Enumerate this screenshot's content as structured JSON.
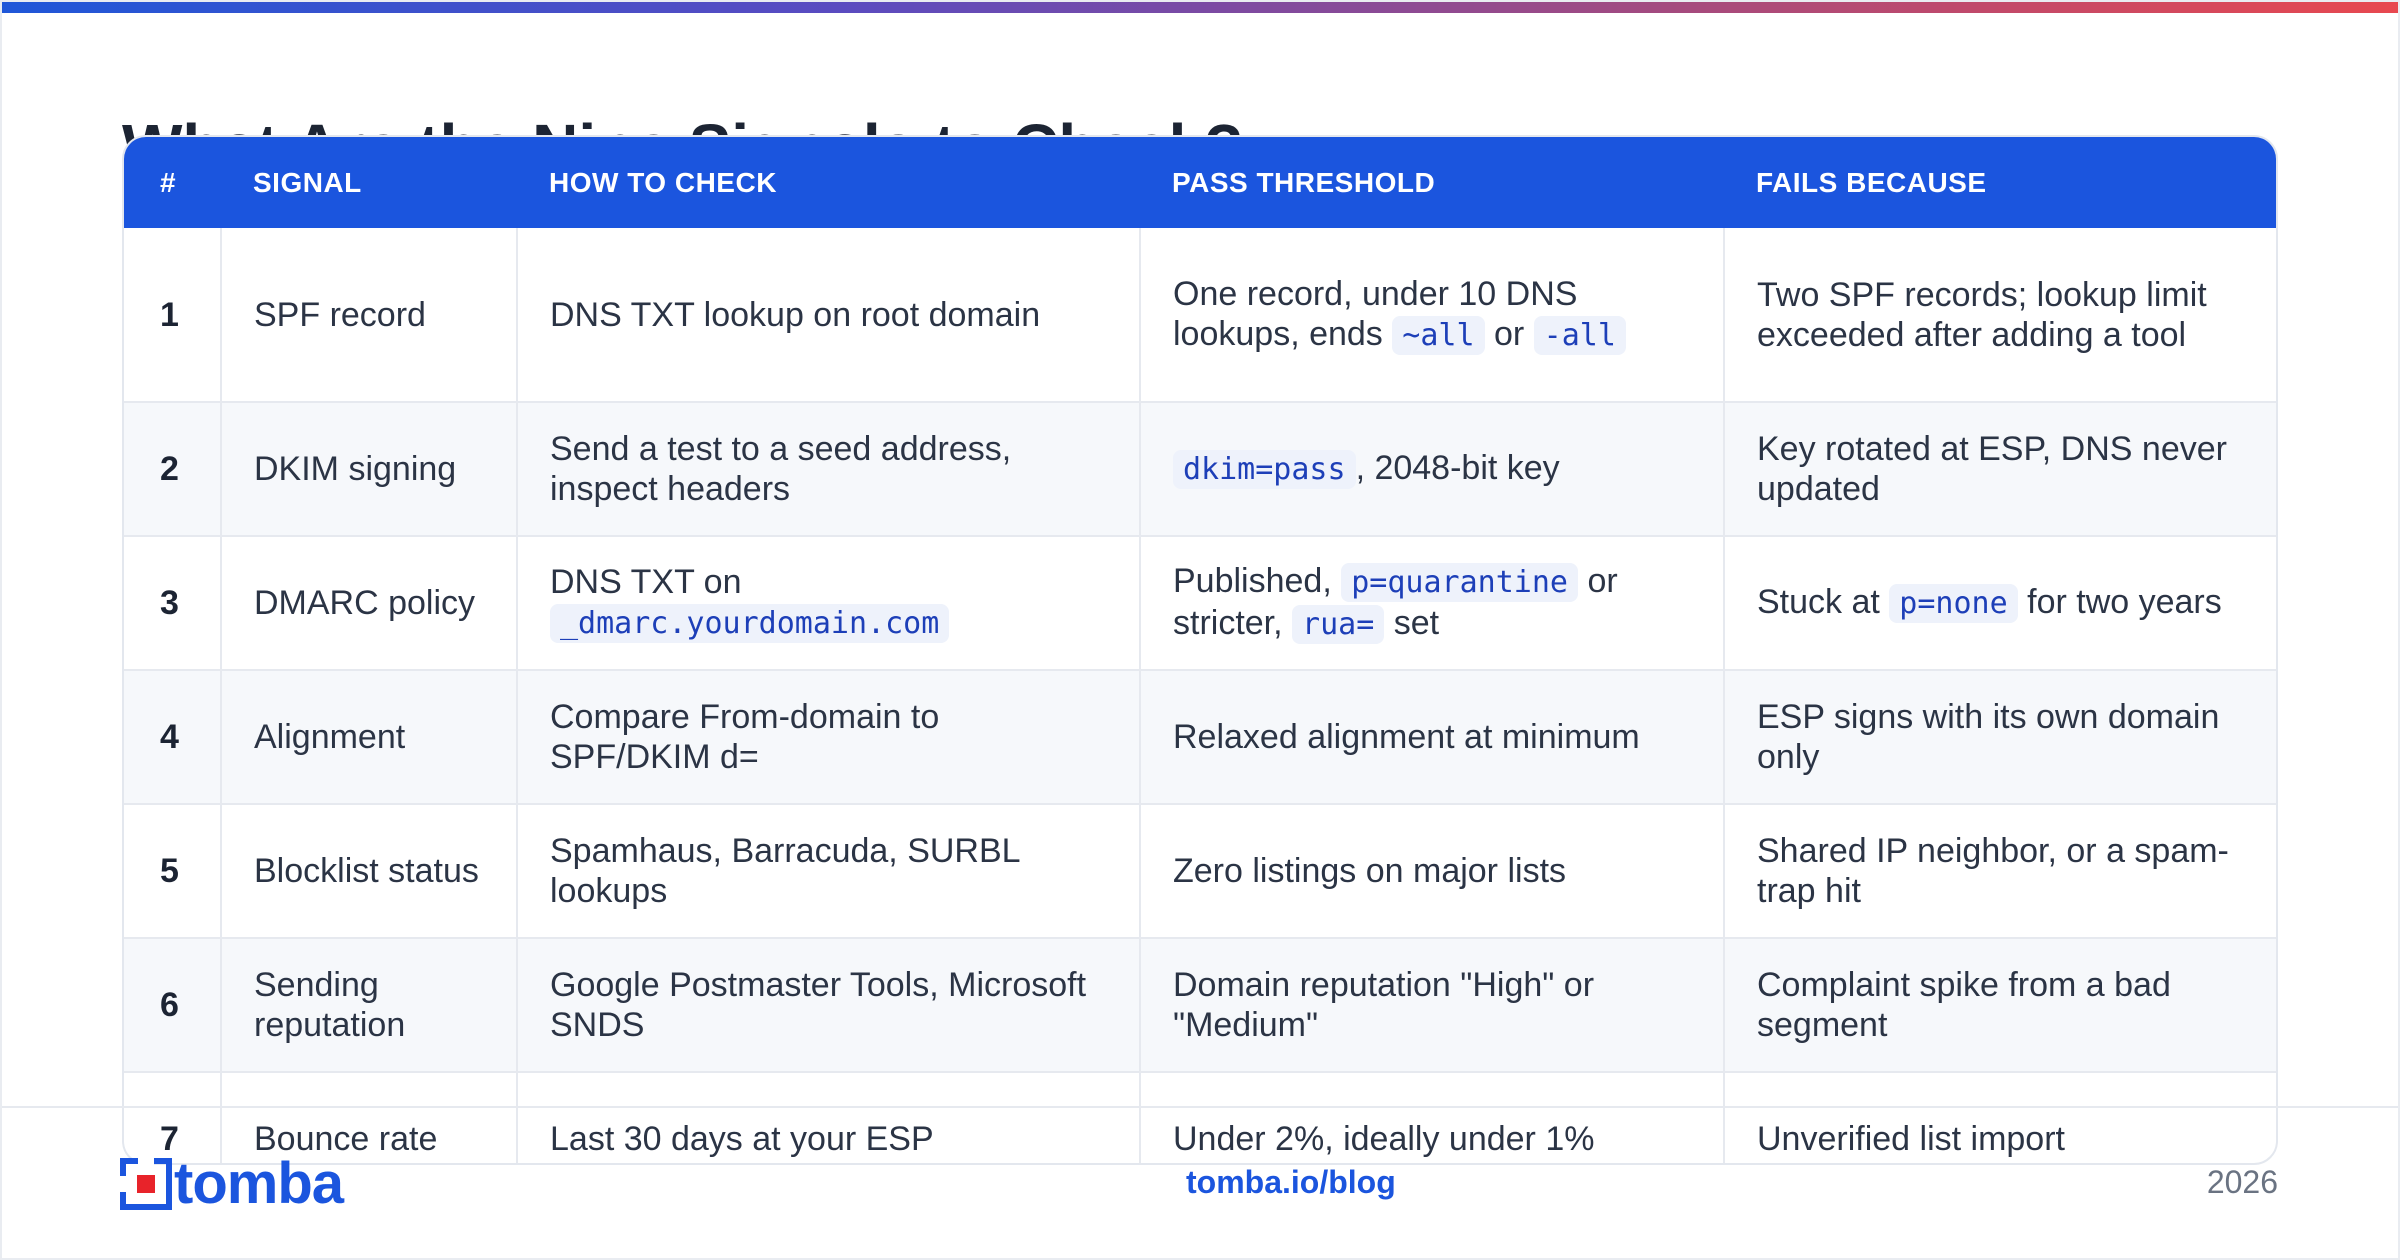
{
  "page": {
    "heading": "What Are the Nine Signals to Check?"
  },
  "table": {
    "headers": {
      "num": "#",
      "signal": "SIGNAL",
      "how": "HOW TO CHECK",
      "pass": "PASS THRESHOLD",
      "fails": "FAILS BECAUSE"
    },
    "rows": [
      {
        "num": "1",
        "signal": "SPF record",
        "how": "DNS TXT lookup on root domain",
        "pass_a": "One record, under 10 DNS lookups, ends",
        "pass_code1": "~all",
        "pass_b": "or",
        "pass_code2": "-all",
        "fails": "Two SPF records; lookup limit exceeded after adding a tool"
      },
      {
        "num": "2",
        "signal": "DKIM signing",
        "how": "Send a test to a seed address, inspect headers",
        "pass_code1": "dkim=pass",
        "pass_a": ", 2048-bit key",
        "fails": "Key rotated at ESP, DNS never updated"
      },
      {
        "num": "3",
        "signal": "DMARC policy",
        "how_a": "DNS TXT on",
        "how_code": "_dmarc.yourdomain.com",
        "pass_a": "Published,",
        "pass_code1": "p=quarantine",
        "pass_b": "or stricter,",
        "pass_code2": "rua=",
        "pass_c": "set",
        "fails_a": "Stuck at",
        "fails_code": "p=none",
        "fails_b": "for two years"
      },
      {
        "num": "4",
        "signal": "Alignment",
        "how": "Compare From-domain to SPF/DKIM d=",
        "pass": "Relaxed alignment at minimum",
        "fails": "ESP signs with its own domain only"
      },
      {
        "num": "5",
        "signal": "Blocklist status",
        "how": "Spamhaus, Barracuda, SURBL lookups",
        "pass": "Zero listings on major lists",
        "fails": "Shared IP neighbor, or a spam-trap hit"
      },
      {
        "num": "6",
        "signal": "Sending reputation",
        "how": "Google Postmaster Tools, Microsoft SNDS",
        "pass": "Domain reputation \"High\" or \"Medium\"",
        "fails": "Complaint spike from a bad segment"
      },
      {
        "num": "7",
        "signal": "Bounce rate",
        "how": "Last 30 days at your ESP",
        "pass": "Under 2%, ideally under 1%",
        "fails": "Unverified list import"
      }
    ]
  },
  "footer": {
    "logo_text": "tomba",
    "link": "tomba.io/blog",
    "year": "2026"
  },
  "colors": {
    "accent": "#1b55de",
    "gradient_start": "#1f57d8",
    "gradient_end": "#e8484f",
    "logo_red": "#e8232a"
  }
}
